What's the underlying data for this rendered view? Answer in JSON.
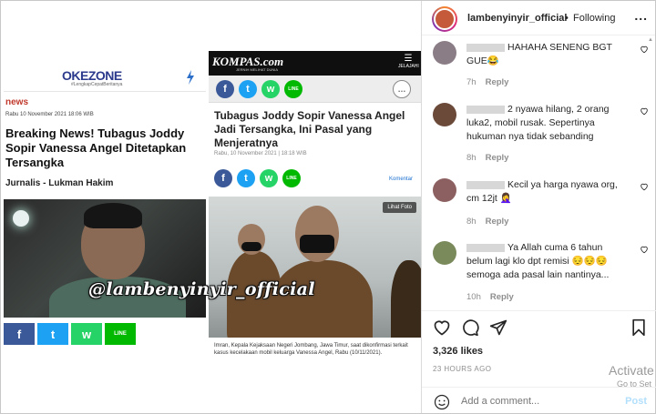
{
  "okezone": {
    "logo": "OKEZONE",
    "tagline": "#LengkapCepatBeritanya",
    "category": "news",
    "date": "Rabu 10 November 2021 18:06 WIB",
    "title": "Breaking News! Tubagus Joddy Sopir Vanessa Angel Ditetapkan Tersangka",
    "author": "Jurnalis - Lukman Hakim",
    "share_fb": "f",
    "share_tw": "t",
    "share_wa": "w",
    "share_line": "LINE"
  },
  "kompas": {
    "logo": "KOMPAS.com",
    "subtitle": "JERNIH MELIHAT DUNIA",
    "menu_label": "JELAJAHI",
    "title": "Tubagus Joddy Sopir Vanessa Angel Jadi Tersangka, Ini Pasal yang Menjeratnya",
    "date": "Rabu, 10 November 2021 | 18:18 WIB",
    "komentar": "Komentar",
    "lihat_foto": "Lihat Foto",
    "caption": "Imran, Kepala Kejaksaan Negeri Jombang, Jawa Timur, saat dikonfirmasi terkait kasus kecelakaan mobil keluarga Vanessa Angel, Rabu (10/11/2021)."
  },
  "watermark": "@lambenyinyir_official",
  "panel": {
    "username": "lambenyinyir_official",
    "dot": "•",
    "follow_status": "Following",
    "more": "...",
    "comments": [
      {
        "text": "HAHAHA SENENG BGT GUE😂",
        "time": "7h",
        "reply": "Reply",
        "avatar_color": "#8a7d86"
      },
      {
        "text": "2 nyawa hilang, 2 orang luka2, mobil rusak. Sepertinya hukuman nya tidak sebanding",
        "time": "8h",
        "reply": "Reply",
        "avatar_color": "#6b4a3a"
      },
      {
        "text": "Kecil ya harga nyawa org, cm 12jt 🤦‍♀️",
        "time": "8h",
        "reply": "Reply",
        "avatar_color": "#8c6060"
      },
      {
        "text": "Ya Allah cuma 6 tahun belum lagi klo dpt remisi 😔😔😔 semoga ada pasal lain nantinya...",
        "time": "10h",
        "reply": "Reply",
        "avatar_color": "#7a8a5a"
      }
    ],
    "likes": "3,326 likes",
    "posted_ago": "23 HOURS AGO",
    "add_comment_placeholder": "Add a comment...",
    "post_label": "Post",
    "activate_line1": "Activate",
    "activate_line2": "Go to Set"
  }
}
